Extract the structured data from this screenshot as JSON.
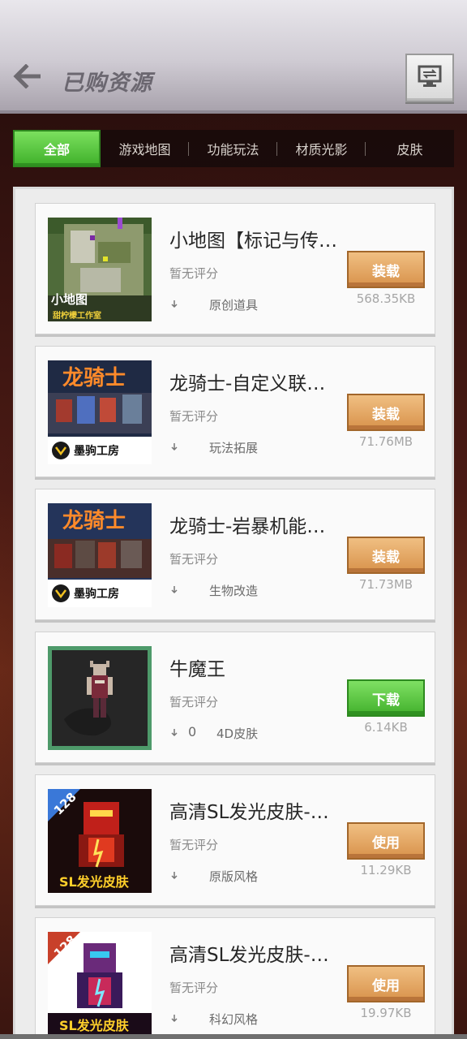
{
  "header": {
    "title": "已购资源",
    "back_icon": "arrow-left-icon",
    "menu_icon": "screen-swap-icon"
  },
  "tabs": [
    {
      "label": "全部",
      "active": true
    },
    {
      "label": "游戏地图",
      "active": false
    },
    {
      "label": "功能玩法",
      "active": false
    },
    {
      "label": "材质光影",
      "active": false
    },
    {
      "label": "皮肤",
      "active": false
    }
  ],
  "items": [
    {
      "title": "小地图【标记与传…",
      "rating": "暂无评分",
      "downloads": "",
      "category": "原创道具",
      "action": "装载",
      "action_color": "orange",
      "size": "568.35KB",
      "thumb_text": "小地图",
      "thumb_sub": "甜柠檬工作室"
    },
    {
      "title": "龙骑士-自定义联…",
      "rating": "暂无评分",
      "downloads": "",
      "category": "玩法拓展",
      "action": "装载",
      "action_color": "orange",
      "size": "71.76MB",
      "thumb_text": "龙骑士",
      "thumb_sub": "墨驹工房"
    },
    {
      "title": "龙骑士-岩暴机能…",
      "rating": "暂无评分",
      "downloads": "",
      "category": "生物改造",
      "action": "装载",
      "action_color": "orange",
      "size": "71.73MB",
      "thumb_text": "龙骑士",
      "thumb_sub": "墨驹工房"
    },
    {
      "title": "牛魔王",
      "rating": "暂无评分",
      "downloads": "0",
      "category": "4D皮肤",
      "action": "下载",
      "action_color": "green",
      "size": "6.14KB",
      "thumb_text": "",
      "thumb_sub": ""
    },
    {
      "title": "高清SL发光皮肤-…",
      "rating": "暂无评分",
      "downloads": "",
      "category": "原版风格",
      "action": "使用",
      "action_color": "orange",
      "size": "11.29KB",
      "thumb_text": "SL发光皮肤",
      "thumb_sub": "128"
    },
    {
      "title": "高清SL发光皮肤-…",
      "rating": "暂无评分",
      "downloads": "",
      "category": "科幻风格",
      "action": "使用",
      "action_color": "orange",
      "size": "19.97KB",
      "thumb_text": "SL发光皮肤",
      "thumb_sub": "128"
    }
  ]
}
